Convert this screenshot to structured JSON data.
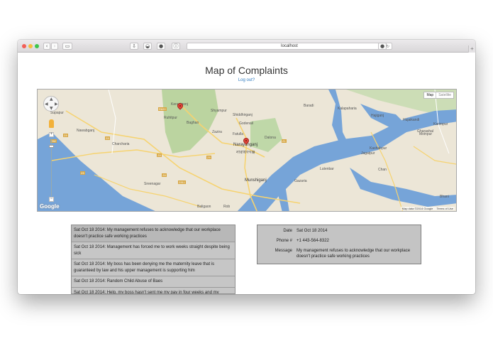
{
  "browser": {
    "url": "localhost"
  },
  "page": {
    "title": "Map of Complaints",
    "logout_label": "Log out?"
  },
  "map": {
    "type_buttons": [
      "Map",
      "Satellite"
    ],
    "attribution": "Map data ©2014 Google",
    "terms": "Terms of Use",
    "google_logo": "Google",
    "labels": [
      "Supapur",
      "Nawabganj",
      "Charcharia",
      "Ruhitpur",
      "Baghan",
      "Shyampur",
      "Shiddhirganj",
      "Godenail",
      "Zazira",
      "Fatulla",
      "Narayanganj",
      "নারায়ণগঞ্জ",
      "Munshiganj",
      "Sreenagar",
      "Baligaon",
      "Gazaria",
      "Baradi",
      "Kalapaharia",
      "Hajiganj",
      "Hujaikandi",
      "Karimpur",
      "Gharashal",
      "Kashabpur",
      "Jagatpur",
      "Chan",
      "Lutenbar",
      "Bhani",
      "Moinpur",
      "Keranigonj",
      "Dalona",
      "Rob"
    ],
    "road_numbers": [
      "Z8",
      "Z82",
      "R820",
      "Z8",
      "Z8",
      "Z811",
      "Z8",
      "Z8",
      "Z1",
      "Z8"
    ]
  },
  "complaints": [
    {
      "text": "Sat Oct 18 2014: My management refuses to acknowledge that our workplace doesn't practice safe working practices"
    },
    {
      "text": "Sat Oct 18 2014: Management has forced me to work weeks straight despite being sick"
    },
    {
      "text": "Sat Oct 18 2014: My boss has been denying me the maternity leave that is guaranteed by law and his upper management is supporting him"
    },
    {
      "text": "Sat Oct 18 2014: Random Child Abuse of Baes"
    },
    {
      "text": "Sat Oct 18 2014: Help, my boss hasn't sent me my pay in four weeks and my"
    }
  ],
  "detail": {
    "date_label": "Date",
    "date_value": "Sat Oct 18 2014",
    "phone_label": "Phone #",
    "phone_value": "+1 443-564-8322",
    "message_label": "Message",
    "message_value": "My management refuses to acknowledge that our workplace doesn't practice safe working practices"
  },
  "colors": {
    "water": "#76a4d8",
    "land": "#ece6d7",
    "park": "#b6d19a",
    "road": "#f6d370",
    "link": "#2f7bc0"
  }
}
